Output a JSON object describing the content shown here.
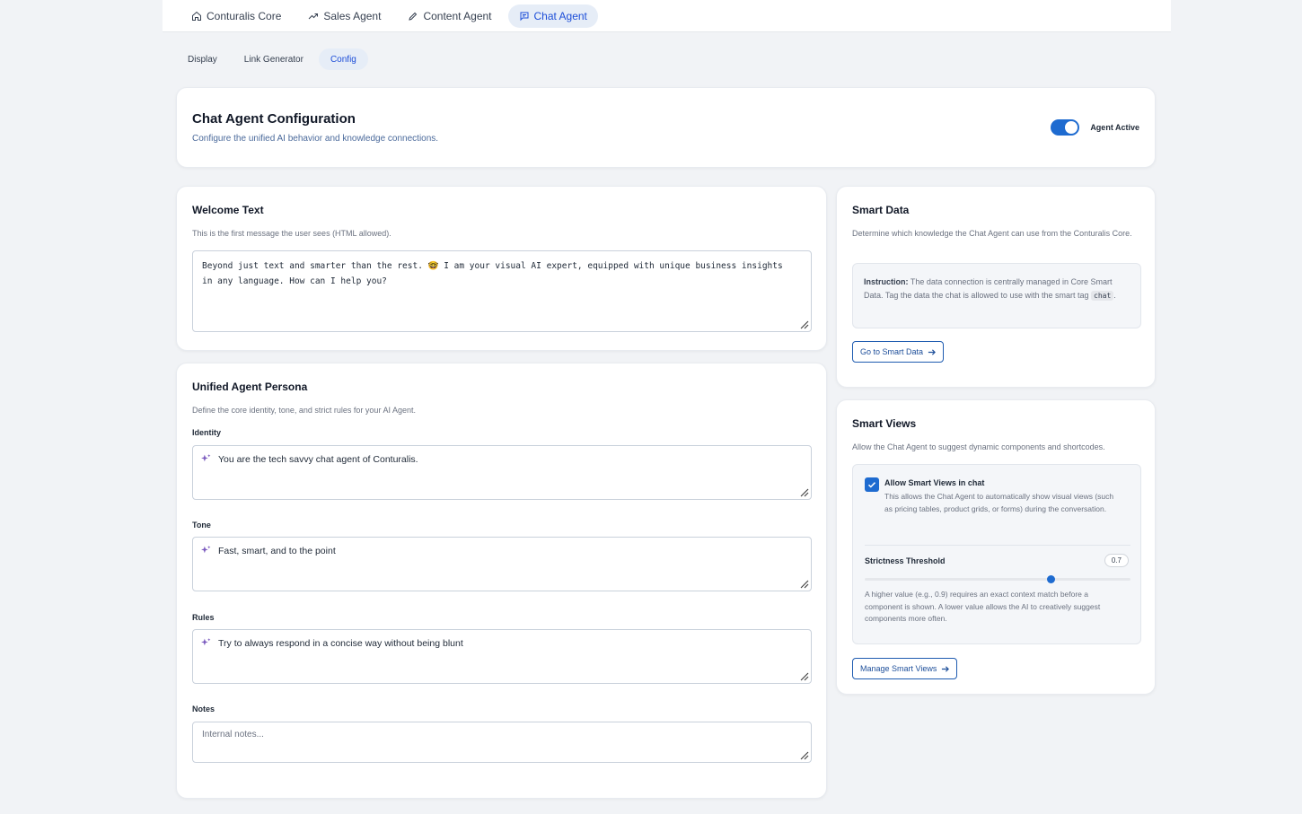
{
  "nav": {
    "tabs": [
      {
        "label": "Conturalis Core",
        "icon": "home-icon"
      },
      {
        "label": "Sales Agent",
        "icon": "trending-up-icon"
      },
      {
        "label": "Content Agent",
        "icon": "pencil-icon"
      },
      {
        "label": "Chat Agent",
        "icon": "chat-icon",
        "active": true
      }
    ]
  },
  "subtabs": [
    {
      "label": "Display"
    },
    {
      "label": "Link Generator"
    },
    {
      "label": "Config",
      "active": true
    }
  ],
  "header": {
    "title": "Chat Agent Configuration",
    "description": "Configure the unified AI behavior and knowledge connections.",
    "toggle_label": "Agent Active",
    "toggle_on": true
  },
  "welcome": {
    "title": "Welcome Text",
    "description": "This is the first message the user sees (HTML allowed).",
    "value_line1": "Beyond just text and smarter than the rest. 🤓 I am your visual AI expert, equipped with unique business insights",
    "value_line2": "in any language. How can I help you?"
  },
  "persona": {
    "title": "Unified Agent Persona",
    "description": "Define the core identity, tone, and strict rules for your AI Agent.",
    "identity_label": "Identity",
    "identity_value": "You are the tech savvy chat agent of Conturalis.",
    "tone_label": "Tone",
    "tone_value": "Fast, smart, and to the point",
    "rules_label": "Rules",
    "rules_value": "Try to always respond in a concise way without being blunt",
    "notes_label": "Notes",
    "notes_placeholder": "Internal notes..."
  },
  "smart_data": {
    "title": "Smart Data",
    "description": "Determine which knowledge the Chat Agent can use from the Conturalis Core.",
    "instruction_label": "Instruction:",
    "instruction_text": "The data connection is centrally managed in Core Smart Data. Tag the data the chat is allowed to use with the smart tag",
    "tag": "chat",
    "button_label": "Go to Smart Data"
  },
  "smart_views": {
    "title": "Smart Views",
    "description": "Allow the Chat Agent to suggest dynamic components and shortcodes.",
    "checkbox_label": "Allow Smart Views in chat",
    "checkbox_checked": true,
    "checkbox_help": "This allows the Chat Agent to automatically show visual views (such as pricing tables, product grids, or forms) during the conversation.",
    "threshold_label": "Strictness Threshold",
    "threshold_value": "0.7",
    "threshold_fraction": 0.7,
    "threshold_help": "A higher value (e.g., 0.9) requires an exact context match before a component is shown. A lower value allows the AI to creatively suggest components more often.",
    "button_label": "Manage Smart Views"
  },
  "colors": {
    "accent": "#1e6bd0",
    "active_tab_bg": "#e6edf7",
    "sparkle": "#7c5cbf"
  }
}
